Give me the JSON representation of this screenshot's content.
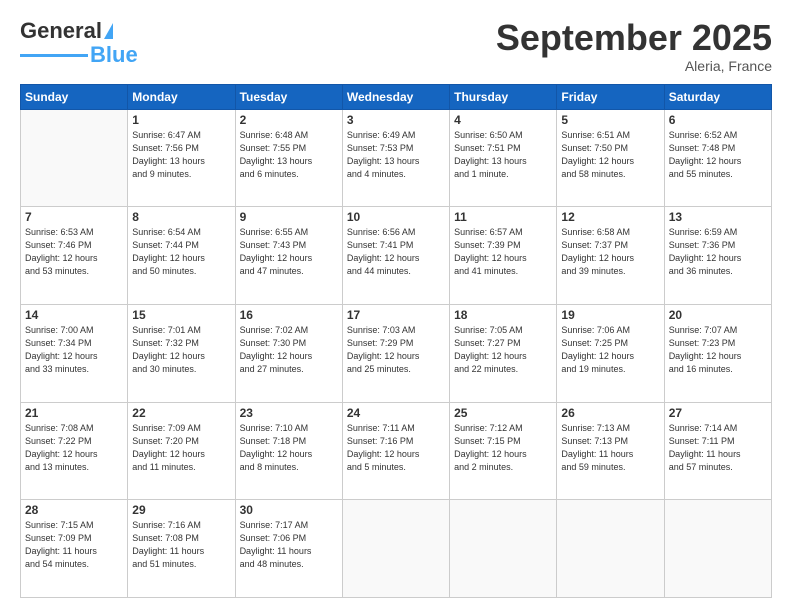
{
  "header": {
    "logo_general": "General",
    "logo_blue": "Blue",
    "month_title": "September 2025",
    "location": "Aleria, France"
  },
  "days_of_week": [
    "Sunday",
    "Monday",
    "Tuesday",
    "Wednesday",
    "Thursday",
    "Friday",
    "Saturday"
  ],
  "weeks": [
    [
      {
        "day": "",
        "info": ""
      },
      {
        "day": "1",
        "info": "Sunrise: 6:47 AM\nSunset: 7:56 PM\nDaylight: 13 hours\nand 9 minutes."
      },
      {
        "day": "2",
        "info": "Sunrise: 6:48 AM\nSunset: 7:55 PM\nDaylight: 13 hours\nand 6 minutes."
      },
      {
        "day": "3",
        "info": "Sunrise: 6:49 AM\nSunset: 7:53 PM\nDaylight: 13 hours\nand 4 minutes."
      },
      {
        "day": "4",
        "info": "Sunrise: 6:50 AM\nSunset: 7:51 PM\nDaylight: 13 hours\nand 1 minute."
      },
      {
        "day": "5",
        "info": "Sunrise: 6:51 AM\nSunset: 7:50 PM\nDaylight: 12 hours\nand 58 minutes."
      },
      {
        "day": "6",
        "info": "Sunrise: 6:52 AM\nSunset: 7:48 PM\nDaylight: 12 hours\nand 55 minutes."
      }
    ],
    [
      {
        "day": "7",
        "info": "Sunrise: 6:53 AM\nSunset: 7:46 PM\nDaylight: 12 hours\nand 53 minutes."
      },
      {
        "day": "8",
        "info": "Sunrise: 6:54 AM\nSunset: 7:44 PM\nDaylight: 12 hours\nand 50 minutes."
      },
      {
        "day": "9",
        "info": "Sunrise: 6:55 AM\nSunset: 7:43 PM\nDaylight: 12 hours\nand 47 minutes."
      },
      {
        "day": "10",
        "info": "Sunrise: 6:56 AM\nSunset: 7:41 PM\nDaylight: 12 hours\nand 44 minutes."
      },
      {
        "day": "11",
        "info": "Sunrise: 6:57 AM\nSunset: 7:39 PM\nDaylight: 12 hours\nand 41 minutes."
      },
      {
        "day": "12",
        "info": "Sunrise: 6:58 AM\nSunset: 7:37 PM\nDaylight: 12 hours\nand 39 minutes."
      },
      {
        "day": "13",
        "info": "Sunrise: 6:59 AM\nSunset: 7:36 PM\nDaylight: 12 hours\nand 36 minutes."
      }
    ],
    [
      {
        "day": "14",
        "info": "Sunrise: 7:00 AM\nSunset: 7:34 PM\nDaylight: 12 hours\nand 33 minutes."
      },
      {
        "day": "15",
        "info": "Sunrise: 7:01 AM\nSunset: 7:32 PM\nDaylight: 12 hours\nand 30 minutes."
      },
      {
        "day": "16",
        "info": "Sunrise: 7:02 AM\nSunset: 7:30 PM\nDaylight: 12 hours\nand 27 minutes."
      },
      {
        "day": "17",
        "info": "Sunrise: 7:03 AM\nSunset: 7:29 PM\nDaylight: 12 hours\nand 25 minutes."
      },
      {
        "day": "18",
        "info": "Sunrise: 7:05 AM\nSunset: 7:27 PM\nDaylight: 12 hours\nand 22 minutes."
      },
      {
        "day": "19",
        "info": "Sunrise: 7:06 AM\nSunset: 7:25 PM\nDaylight: 12 hours\nand 19 minutes."
      },
      {
        "day": "20",
        "info": "Sunrise: 7:07 AM\nSunset: 7:23 PM\nDaylight: 12 hours\nand 16 minutes."
      }
    ],
    [
      {
        "day": "21",
        "info": "Sunrise: 7:08 AM\nSunset: 7:22 PM\nDaylight: 12 hours\nand 13 minutes."
      },
      {
        "day": "22",
        "info": "Sunrise: 7:09 AM\nSunset: 7:20 PM\nDaylight: 12 hours\nand 11 minutes."
      },
      {
        "day": "23",
        "info": "Sunrise: 7:10 AM\nSunset: 7:18 PM\nDaylight: 12 hours\nand 8 minutes."
      },
      {
        "day": "24",
        "info": "Sunrise: 7:11 AM\nSunset: 7:16 PM\nDaylight: 12 hours\nand 5 minutes."
      },
      {
        "day": "25",
        "info": "Sunrise: 7:12 AM\nSunset: 7:15 PM\nDaylight: 12 hours\nand 2 minutes."
      },
      {
        "day": "26",
        "info": "Sunrise: 7:13 AM\nSunset: 7:13 PM\nDaylight: 11 hours\nand 59 minutes."
      },
      {
        "day": "27",
        "info": "Sunrise: 7:14 AM\nSunset: 7:11 PM\nDaylight: 11 hours\nand 57 minutes."
      }
    ],
    [
      {
        "day": "28",
        "info": "Sunrise: 7:15 AM\nSunset: 7:09 PM\nDaylight: 11 hours\nand 54 minutes."
      },
      {
        "day": "29",
        "info": "Sunrise: 7:16 AM\nSunset: 7:08 PM\nDaylight: 11 hours\nand 51 minutes."
      },
      {
        "day": "30",
        "info": "Sunrise: 7:17 AM\nSunset: 7:06 PM\nDaylight: 11 hours\nand 48 minutes."
      },
      {
        "day": "",
        "info": ""
      },
      {
        "day": "",
        "info": ""
      },
      {
        "day": "",
        "info": ""
      },
      {
        "day": "",
        "info": ""
      }
    ]
  ]
}
